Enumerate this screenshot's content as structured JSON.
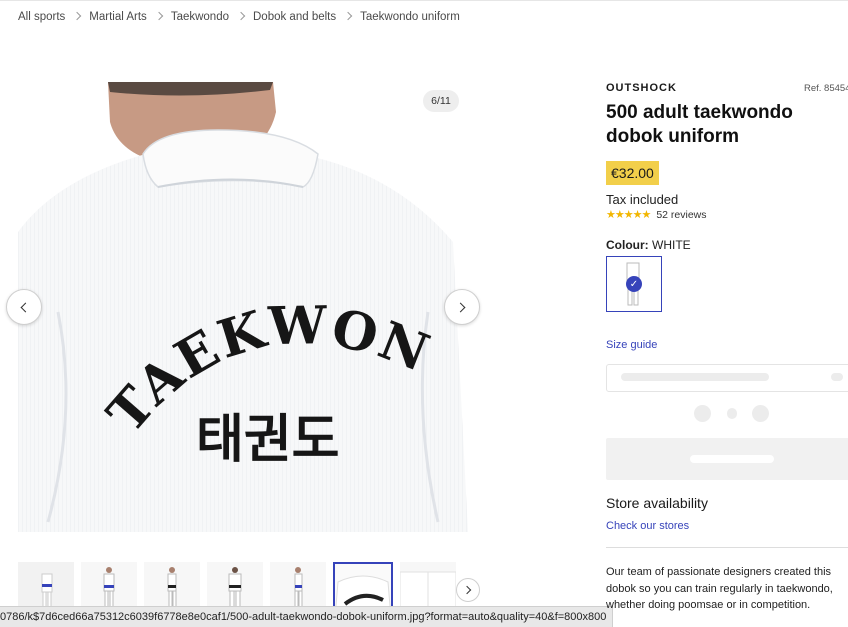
{
  "breadcrumb": [
    "All sports",
    "Martial Arts",
    "Taekwondo",
    "Dobok and belts",
    "Taekwondo uniform"
  ],
  "gallery": {
    "counter": "6/11",
    "image_text_line1": "TAEKWONDO",
    "image_text_line2": "태권도",
    "thumbnail_count": 8,
    "active_thumbnail": 6
  },
  "product": {
    "brand": "OUTSHOCK",
    "ref": "Ref. 85454",
    "title": "500 adult taekwondo dobok uniform",
    "price": "€32.00",
    "tax_note": "Tax included",
    "rating": 5,
    "rating_stars": "★★★★★",
    "reviews": "52 reviews",
    "colour_label": "Colour:",
    "colour_value": "WHITE",
    "size_guide": "Size guide",
    "store_availability": "Store availability",
    "check_stores": "Check our stores",
    "description": "Our team of passionate designers created this dobok so you can train regularly in taekwondo, whether doing poomsae or in competition."
  },
  "status_url": "0786/k$7d6ced66a75312c6039f6778e8e0caf1/500-adult-taekwondo-dobok-uniform.jpg?format=auto&quality=40&f=800x800",
  "colors": {
    "accent": "#3643ba",
    "price_bg": "#f2cf4a",
    "star": "#f2b600"
  }
}
